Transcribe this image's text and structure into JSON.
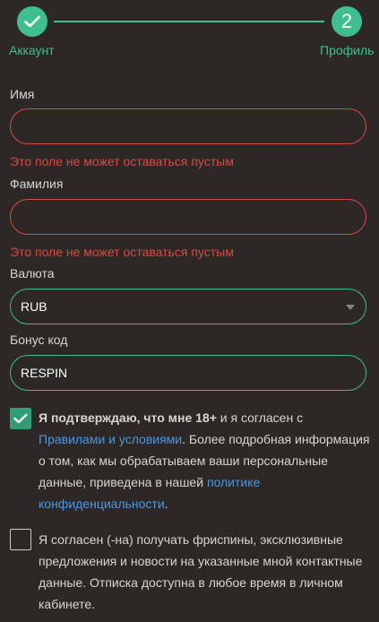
{
  "stepper": {
    "step1_label": "Аккаунт",
    "step2_number": "2",
    "step2_label": "Профиль"
  },
  "form": {
    "first_name": {
      "label": "Имя",
      "value": "",
      "error": "Это поле не может оставаться пустым"
    },
    "last_name": {
      "label": "Фамилия",
      "value": "",
      "error": "Это поле не может оставаться пустым"
    },
    "currency": {
      "label": "Валюта",
      "value": "RUB"
    },
    "bonus": {
      "label": "Бонус код",
      "value": "RESPIN"
    }
  },
  "consents": {
    "terms": {
      "checked": true,
      "bold": "Я подтверждаю, что мне 18+",
      "text1": " и я согласен с ",
      "link1": "Правилами и условиями",
      "text2": ". Более подробная информация о том, как мы обрабатываем ваши персональные данные, приведена в нашей ",
      "link2": "политике конфиденциальности",
      "text3": "."
    },
    "marketing": {
      "checked": false,
      "text": "Я согласен (-на) получать фриспины, эксклюзивные предложения и новости на указанные мной контактные данные. Отписка доступна в любое время в личном кабинете."
    }
  },
  "colors": {
    "accent": "#3fbf8f",
    "error": "#d64a42",
    "link": "#4b97e0",
    "background": "#2d2826"
  }
}
